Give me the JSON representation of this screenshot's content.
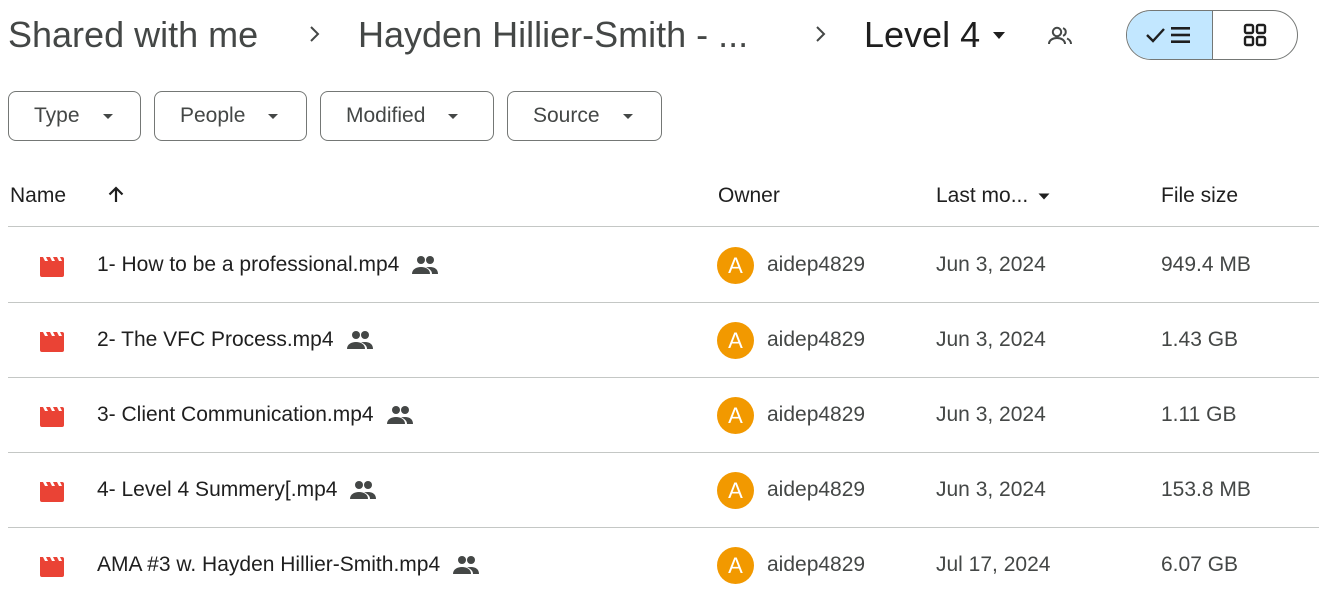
{
  "breadcrumb": {
    "root": "Shared with me",
    "parent": "Hayden Hillier-Smith - ...",
    "current": "Level 4"
  },
  "view_toggle": {
    "active": "list",
    "list_icon": "check-list-icon",
    "grid_icon": "grid-icon"
  },
  "filters": [
    {
      "label": "Type"
    },
    {
      "label": "People"
    },
    {
      "label": "Modified"
    },
    {
      "label": "Source"
    }
  ],
  "table": {
    "headers": {
      "name": "Name",
      "owner": "Owner",
      "modified": "Last mo...",
      "size": "File size"
    },
    "sort": "ascending",
    "rows": [
      {
        "name": "1- How to be a professional.mp4",
        "owner_initial": "A",
        "owner": "aidep4829",
        "modified": "Jun 3, 2024",
        "size": "949.4 MB"
      },
      {
        "name": "2- The VFC Process.mp4",
        "owner_initial": "A",
        "owner": "aidep4829",
        "modified": "Jun 3, 2024",
        "size": "1.43 GB"
      },
      {
        "name": "3- Client Communication.mp4",
        "owner_initial": "A",
        "owner": "aidep4829",
        "modified": "Jun 3, 2024",
        "size": "1.11 GB"
      },
      {
        "name": "4- Level 4 Summery[.mp4",
        "owner_initial": "A",
        "owner": "aidep4829",
        "modified": "Jun 3, 2024",
        "size": "153.8 MB"
      },
      {
        "name": "AMA #3 w. Hayden Hillier-Smith.mp4",
        "owner_initial": "A",
        "owner": "aidep4829",
        "modified": "Jul 17, 2024",
        "size": "6.07 GB"
      }
    ]
  },
  "colors": {
    "video_icon": "#ea4335",
    "avatar": "#f29900",
    "toggle_active": "#c2e7ff"
  }
}
